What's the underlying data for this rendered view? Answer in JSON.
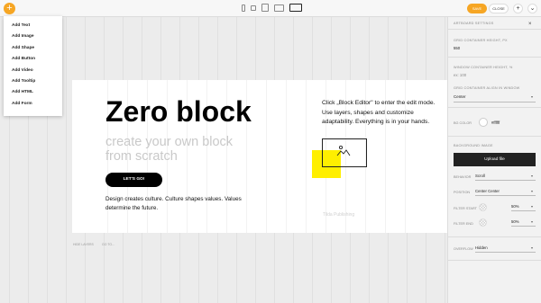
{
  "toolbar": {
    "add_symbol": "+",
    "save_label": "SAVE",
    "close_label": "CLOSE",
    "plus_label": "+",
    "more_label": "⌄"
  },
  "add_menu": {
    "items": [
      "Add Text",
      "Add Image",
      "Add Shape",
      "Add Button",
      "Add Video",
      "Add Tooltip",
      "Add HTML",
      "Add Form"
    ]
  },
  "block": {
    "title": "Zero block",
    "subtitle": "create your own block from scratch",
    "button_label": "LET'S GO!",
    "description": "Design creates culture. Culture shapes values. Values determine the future.",
    "right_text": "Click „Block Editor\" to enter the edit mode. Use layers, shapes and customize adaptability. Everything is in your hands.",
    "watermark": "Tilda Publishing"
  },
  "below_labels": {
    "left": "HIDE LAYERS",
    "right": "GO TO..."
  },
  "panel": {
    "section_title": "ARTBOARD SETTINGS",
    "close_icon": "×",
    "container_height_label": "GRID CONTAINER HEIGHT, PX",
    "container_height_value": "550",
    "window_height_label": "WINDOW CONTAINER HEIGHT, %",
    "window_height_value": "ex: 100",
    "align_label": "GRID CONTAINER ALIGN IN WINDOW",
    "align_value": "Center",
    "bg_color_label": "BG COLOR",
    "bg_color_value": "#ffffff",
    "bg_image_label": "BACKGROUND IMAGE",
    "upload_label": "Upload file",
    "behavior_label": "BEHAVIOR",
    "behavior_value": "Scroll",
    "position_label": "POSITION",
    "position_value": "Center Center",
    "filter_start_label": "FILTER START",
    "filter_start_value": "50%",
    "filter_end_label": "FILTER END",
    "filter_end_value": "50%",
    "overflow_label": "OVERFLOW",
    "overflow_value": "Hidden"
  }
}
